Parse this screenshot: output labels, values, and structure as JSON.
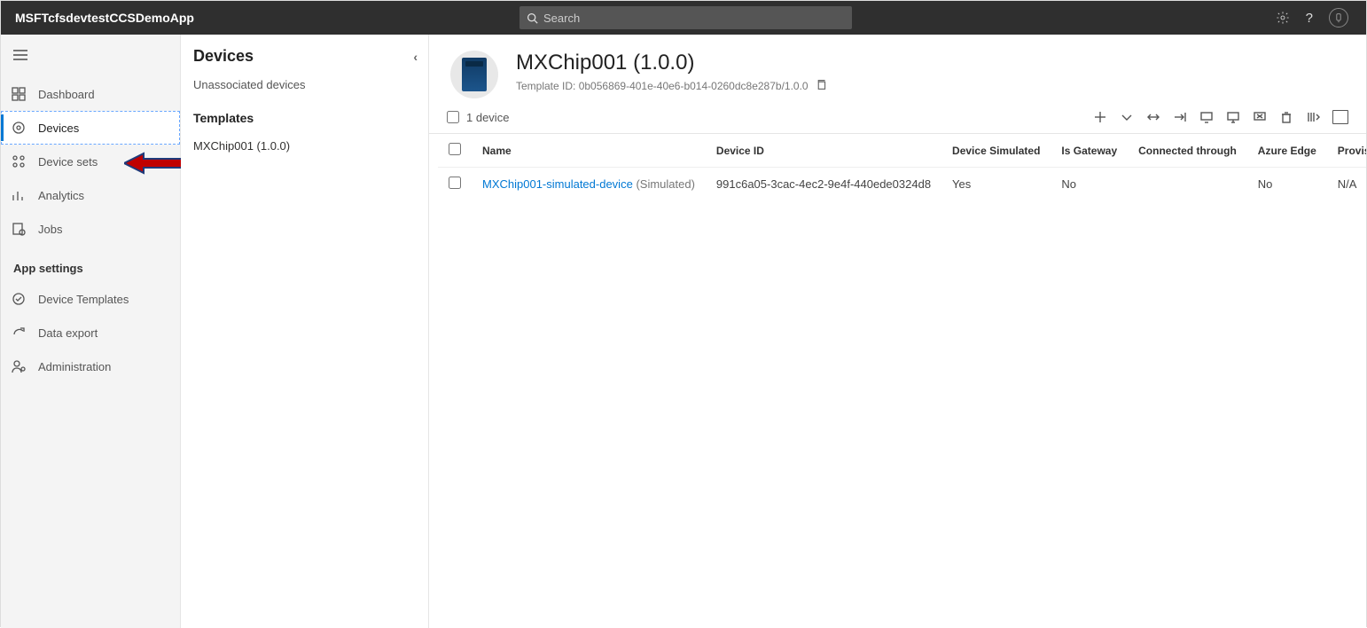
{
  "topbar": {
    "app_title": "MSFTcfsdevtestCCSDemoApp",
    "search_placeholder": "Search"
  },
  "nav": {
    "items": [
      {
        "key": "dashboard",
        "label": "Dashboard"
      },
      {
        "key": "devices",
        "label": "Devices"
      },
      {
        "key": "device-sets",
        "label": "Device sets"
      },
      {
        "key": "analytics",
        "label": "Analytics"
      },
      {
        "key": "jobs",
        "label": "Jobs"
      }
    ],
    "section_label": "App settings",
    "settings_items": [
      {
        "key": "device-templates",
        "label": "Device Templates"
      },
      {
        "key": "data-export",
        "label": "Data export"
      },
      {
        "key": "administration",
        "label": "Administration"
      }
    ]
  },
  "subcol": {
    "header": "Devices",
    "unassociated": "Unassociated devices",
    "templates_label": "Templates",
    "templates": [
      {
        "label": "MXChip001 (1.0.0)"
      }
    ]
  },
  "main": {
    "title": "MXChip001 (1.0.0)",
    "template_id_label": "Template ID: 0b056869-401e-40e6-b014-0260dc8e287b/1.0.0",
    "count_label": "1 device"
  },
  "table": {
    "headers": {
      "name": "Name",
      "device_id": "Device ID",
      "simulated": "Device Simulated",
      "gateway": "Is Gateway",
      "connected": "Connected through",
      "edge": "Azure Edge",
      "provisioning": "Provisioning Stat"
    },
    "rows": [
      {
        "name": "MXChip001-simulated-device",
        "suffix": "(Simulated)",
        "device_id": "991c6a05-3cac-4ec2-9e4f-440ede0324d8",
        "simulated": "Yes",
        "gateway": "No",
        "connected": "",
        "edge": "No",
        "provisioning": "N/A"
      }
    ]
  }
}
